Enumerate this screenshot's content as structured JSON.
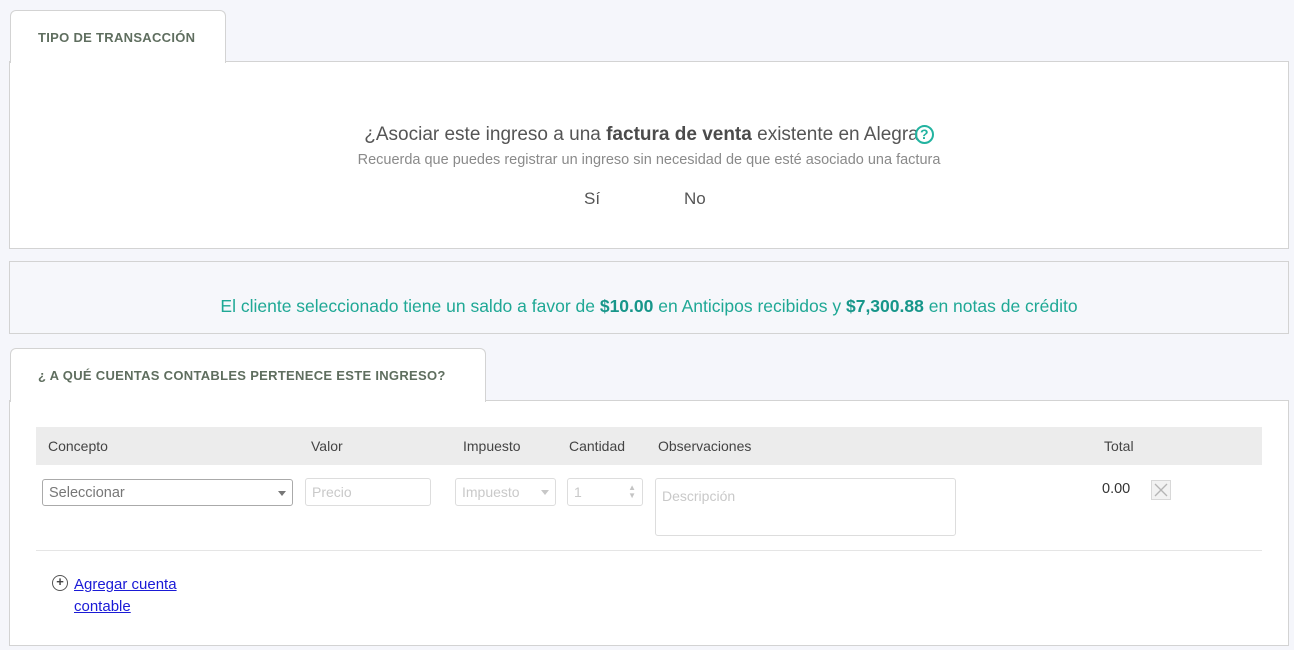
{
  "transaction_tab": {
    "label": "TIPO DE TRANSACCIÓN"
  },
  "association": {
    "question_prefix": "¿Asociar este ingreso a una ",
    "question_bold": "factura de venta",
    "question_suffix": " existente en Alegra",
    "help_icon": "?",
    "hint": "Recuerda que puedes registrar un ingreso sin necesidad de que esté asociado una factura",
    "option_yes": "Sí",
    "option_no": "No"
  },
  "balance": {
    "text_1": "El cliente seleccionado tiene un saldo a favor de ",
    "amount_1": "$10.00",
    "text_2": " en Anticipos recibidos y ",
    "amount_2": "$7,300.88",
    "text_3": " en notas de crédito",
    "accent_color": "#1fa895"
  },
  "accounts_tab": {
    "label": "¿ A QUÉ CUENTAS CONTABLES PERTENECE ESTE INGRESO?"
  },
  "table": {
    "headers": {
      "concepto": "Concepto",
      "valor": "Valor",
      "impuesto": "Impuesto",
      "cantidad": "Cantidad",
      "observaciones": "Observaciones",
      "total": "Total"
    },
    "row": {
      "concepto_selected": "Seleccionar",
      "precio_placeholder": "Precio",
      "impuesto_selected": "Impuesto",
      "cantidad_value": "1",
      "descripcion_placeholder": "Descripción",
      "total": "0.00"
    }
  },
  "add_account": {
    "label": "Agregar cuenta contable"
  }
}
